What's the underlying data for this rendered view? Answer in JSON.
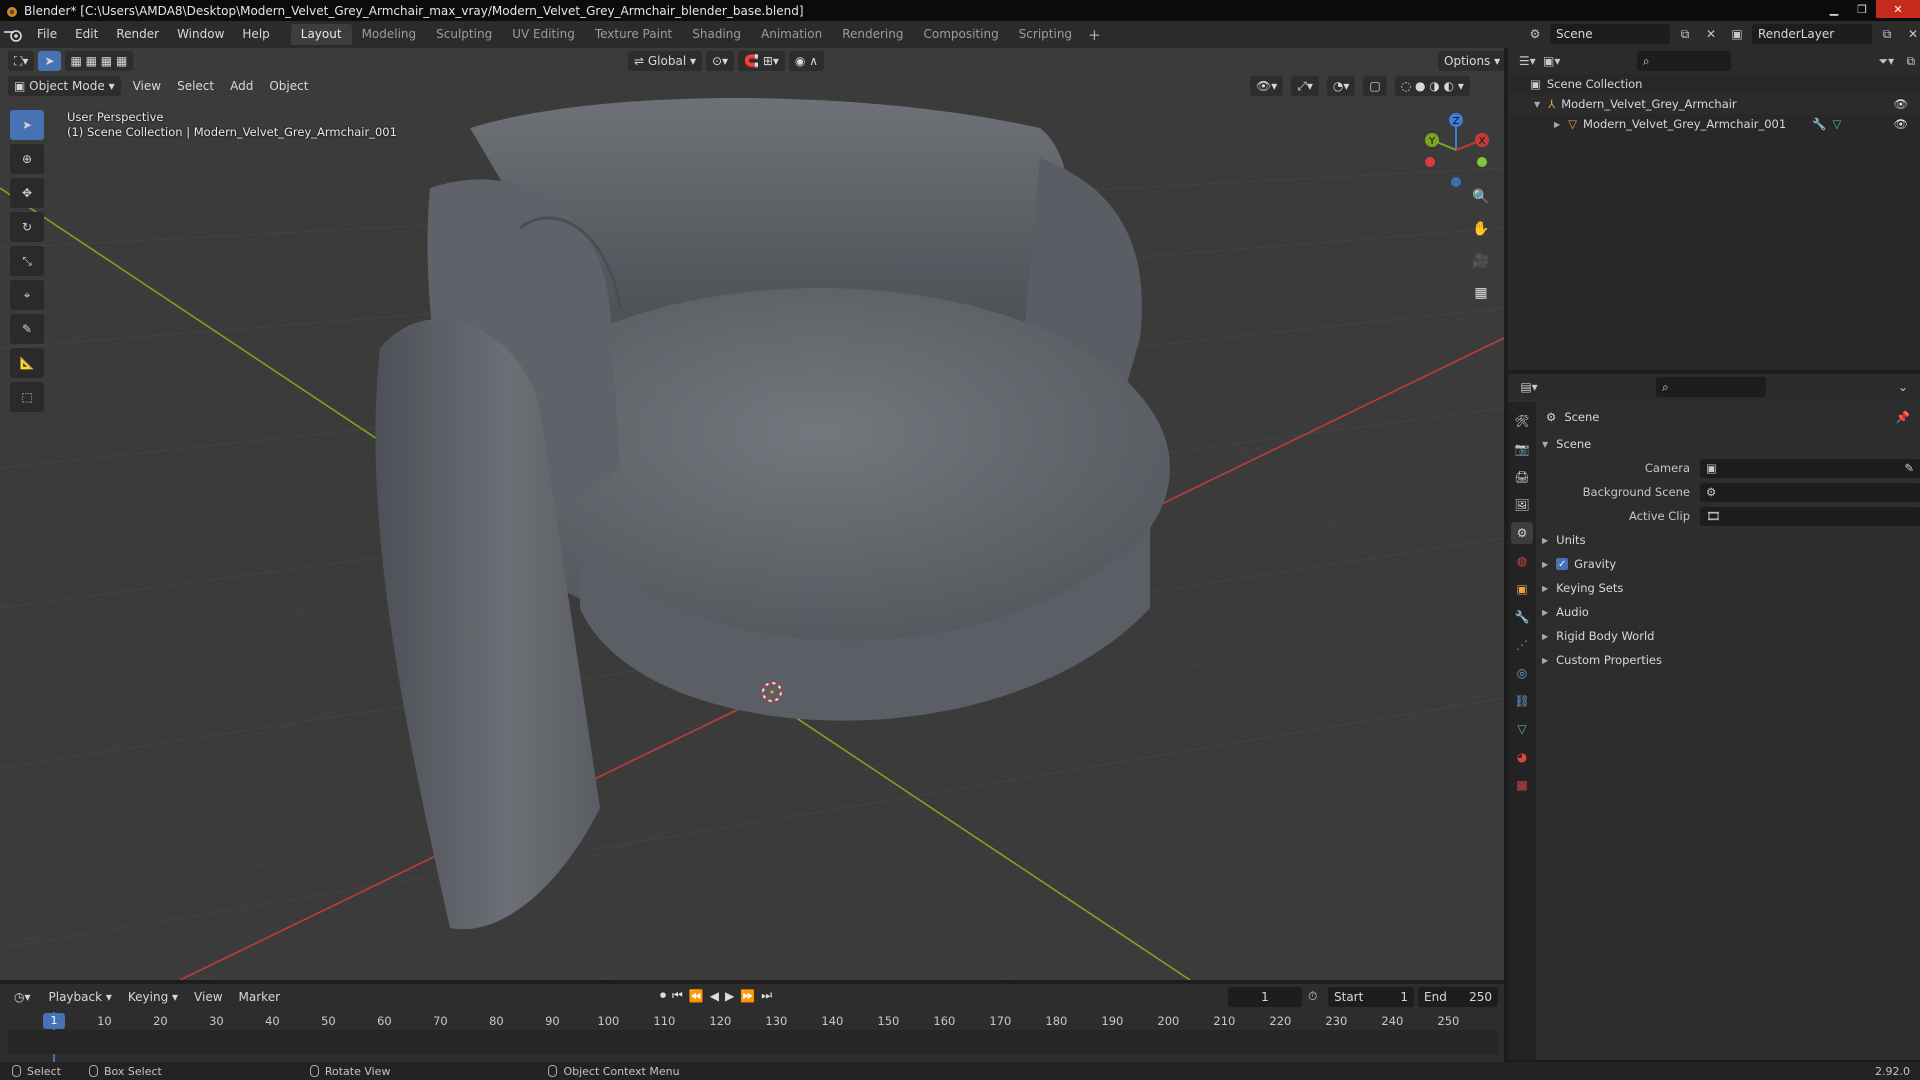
{
  "window": {
    "title": "Blender* [C:\\Users\\AMDA8\\Desktop\\Modern_Velvet_Grey_Armchair_max_vray/Modern_Velvet_Grey_Armchair_blender_base.blend]",
    "minimize": "▁",
    "maximize": "❐",
    "close": "✕"
  },
  "menu": [
    "File",
    "Edit",
    "Render",
    "Window",
    "Help"
  ],
  "workspaces": [
    "Layout",
    "Modeling",
    "Sculpting",
    "UV Editing",
    "Texture Paint",
    "Shading",
    "Animation",
    "Rendering",
    "Compositing",
    "Scripting"
  ],
  "workspace_add": "+",
  "scene_selector": {
    "value": "Scene"
  },
  "view_layer": {
    "value": "RenderLayer"
  },
  "viewport": {
    "mode": "Object Mode",
    "menus": [
      "View",
      "Select",
      "Add",
      "Object"
    ],
    "transform_orientation": "Global",
    "options_label": "Options",
    "perspective_label": "User Perspective",
    "collection_label": "(1) Scene Collection | Modern_Velvet_Grey_Armchair_001",
    "gizmo": {
      "x": "X",
      "y": "Y",
      "z": "Z"
    }
  },
  "outliner": {
    "root": "Scene Collection",
    "items": [
      {
        "label": "Modern_Velvet_Grey_Armchair"
      },
      {
        "label": "Modern_Velvet_Grey_Armchair_001"
      }
    ]
  },
  "properties": {
    "context_label": "Scene",
    "panel_title": "Scene",
    "fields": [
      {
        "label": "Camera",
        "value": ""
      },
      {
        "label": "Background Scene",
        "value": ""
      },
      {
        "label": "Active Clip",
        "value": ""
      }
    ],
    "subpanels": [
      "Units",
      "Gravity",
      "Keying Sets",
      "Audio",
      "Rigid Body World",
      "Custom Properties"
    ],
    "gravity_checked": true
  },
  "timeline": {
    "menus": [
      "Playback",
      "Keying",
      "View",
      "Marker"
    ],
    "current_frame": "1",
    "start_label": "Start",
    "start_value": "1",
    "end_label": "End",
    "end_value": "250",
    "ruler": [
      "1",
      "10",
      "20",
      "30",
      "40",
      "50",
      "60",
      "70",
      "80",
      "90",
      "100",
      "110",
      "120",
      "130",
      "140",
      "150",
      "160",
      "170",
      "180",
      "190",
      "200",
      "210",
      "220",
      "230",
      "240",
      "250"
    ]
  },
  "statusbar": {
    "select": "Select",
    "box_select": "Box Select",
    "rotate_view": "Rotate View",
    "context_menu": "Object Context Menu",
    "version": "2.92.0"
  },
  "colors": {
    "accent": "#4772b3",
    "axis_x": "#c23b3b",
    "axis_y": "#7da321",
    "chair": "#6b6e74"
  }
}
